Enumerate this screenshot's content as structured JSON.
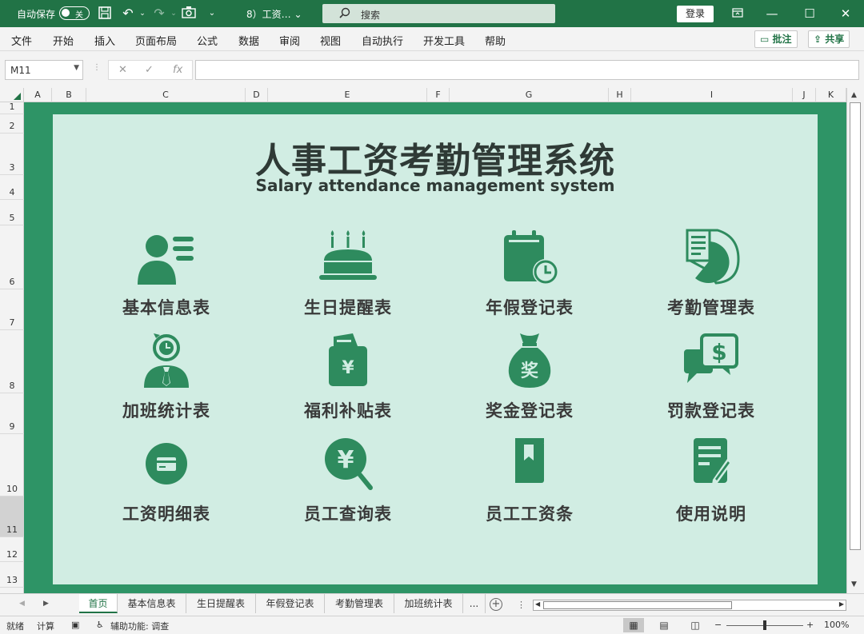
{
  "titlebar": {
    "autosave_label": "自动保存",
    "autosave_state": "关",
    "doc_name": "8）工资… ⌄",
    "search_placeholder": "搜索",
    "login_label": "登录"
  },
  "menu": [
    "文件",
    "开始",
    "插入",
    "页面布局",
    "公式",
    "数据",
    "审阅",
    "视图",
    "自动执行",
    "开发工具",
    "帮助"
  ],
  "ribbon_right": {
    "comments_label": "批注",
    "share_label": "共享"
  },
  "formula": {
    "name_box": "M11",
    "cancel": "✕",
    "enter": "✓",
    "fx": "fx",
    "value": ""
  },
  "columns": [
    "A",
    "B",
    "C",
    "D",
    "E",
    "F",
    "G",
    "H",
    "I",
    "J",
    "K"
  ],
  "rows": [
    "1",
    "2",
    "3",
    "4",
    "5",
    "6",
    "7",
    "8",
    "9",
    "10",
    "11",
    "12",
    "13"
  ],
  "dashboard": {
    "title": "人事工资考勤管理系统",
    "subtitle": "Salary attendance management system",
    "tiles": [
      {
        "label": "基本信息表",
        "icon": "person-card-icon"
      },
      {
        "label": "生日提醒表",
        "icon": "birthday-cake-icon"
      },
      {
        "label": "年假登记表",
        "icon": "calendar-clock-icon"
      },
      {
        "label": "考勤管理表",
        "icon": "document-pie-icon"
      },
      {
        "label": "加班统计表",
        "icon": "overtime-person-icon"
      },
      {
        "label": "福利补贴表",
        "icon": "money-envelope-icon"
      },
      {
        "label": "奖金登记表",
        "icon": "money-bag-icon"
      },
      {
        "label": "罚款登记表",
        "icon": "dollar-chat-icon"
      },
      {
        "label": "工资明细表",
        "icon": "card-circle-icon"
      },
      {
        "label": "员工查询表",
        "icon": "yuan-search-icon"
      },
      {
        "label": "员工工资条",
        "icon": "book-bookmark-icon"
      },
      {
        "label": "使用说明",
        "icon": "note-pen-icon"
      }
    ]
  },
  "sheet_tabs": [
    "首页",
    "基本信息表",
    "生日提醒表",
    "年假登记表",
    "考勤管理表",
    "加班统计表"
  ],
  "tabs_more": "...",
  "status": {
    "ready": "就绪",
    "calc": "计算",
    "accessibility": "辅助功能: 调查",
    "zoom": "100%"
  },
  "colors": {
    "excel_green": "#217346",
    "sheet_green": "#2e9466",
    "panel_bg": "#d1ede3",
    "icon_green": "#2e8b5e"
  }
}
